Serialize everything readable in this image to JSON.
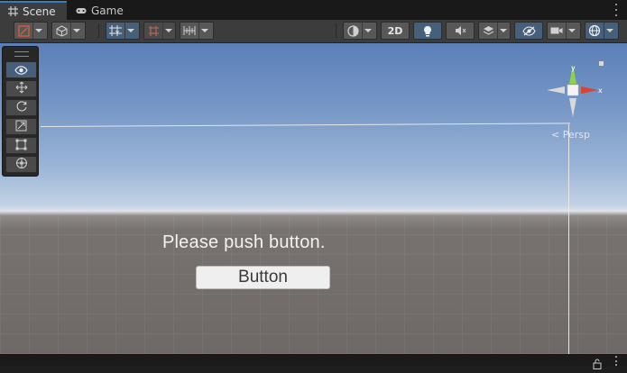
{
  "tabs": [
    {
      "label": "Scene",
      "icon": "scene-grid-icon",
      "active": true
    },
    {
      "label": "Game",
      "icon": "gamepad-icon",
      "active": false
    }
  ],
  "toolbar": {
    "mode_2d_label": "2D"
  },
  "tools": [
    "view-tool-icon",
    "move-tool-icon",
    "rotate-tool-icon",
    "scale-tool-icon",
    "rect-tool-icon",
    "transform-tool-icon"
  ],
  "gizmo": {
    "y_label": "y",
    "x_label": "x",
    "persp_label": "< Persp"
  },
  "scene_ui": {
    "prompt_text": "Please push button.",
    "button_label": "Button"
  },
  "colors": {
    "accent": "#3a79bb",
    "selected": "#46607c",
    "gizmo_y": "#8ed24b",
    "gizmo_x": "#d8442e"
  }
}
